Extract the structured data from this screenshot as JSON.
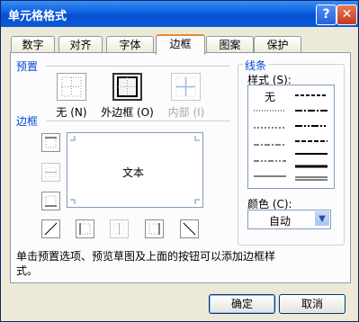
{
  "window": {
    "title": "单元格格式",
    "help_glyph": "?",
    "close_glyph": "✕"
  },
  "tabs": [
    {
      "label": "数字"
    },
    {
      "label": "对齐"
    },
    {
      "label": "字体"
    },
    {
      "label": "边框",
      "active": true
    },
    {
      "label": "图案"
    },
    {
      "label": "保护"
    }
  ],
  "presets": {
    "label": "预置",
    "none": "无 (N)",
    "outline": "外边框 (O)",
    "inside": "内部 (I)"
  },
  "border": {
    "label": "边框",
    "preview_text": "文本"
  },
  "line": {
    "label": "线条",
    "style_label": "样式 (S):",
    "style_none": "无",
    "color_label": "颜色 (C):",
    "color_value": "自动"
  },
  "hint": "单击预置选项、预览草图及上面的按钮可以添加边框样式。",
  "buttons": {
    "ok": "确定",
    "cancel": "取消"
  },
  "colors": {
    "title_bar": "#0b5fe0",
    "accent": "#0046d5"
  }
}
